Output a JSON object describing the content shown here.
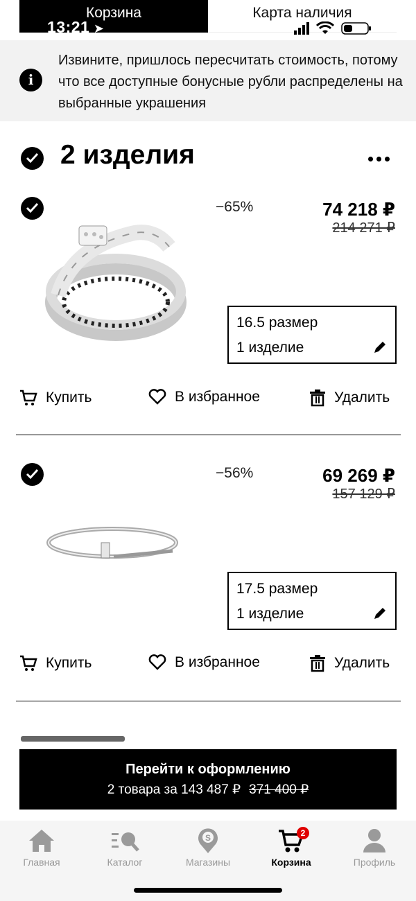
{
  "top_tabs": {
    "active": "Корзина",
    "inactive": "Карта наличия"
  },
  "status_bar": {
    "time": "13:21"
  },
  "notice": {
    "icon": "info-icon",
    "text": "Извините, пришлось пересчитать стоимость, потому что все доступные бонусные рубли распределены на выбранные украшения"
  },
  "header": {
    "title": "2 изделия",
    "more_icon": "more-dots-icon"
  },
  "products": [
    {
      "image": "serpent-ring-image",
      "discount": "−65%",
      "price": "74 218 ₽",
      "old_price": "214 271 ₽",
      "size": "16.5 размер",
      "quantity": "1 изделие"
    },
    {
      "image": "nail-bracelet-image",
      "discount": "−56%",
      "price": "69 269 ₽",
      "old_price": "157 129 ₽",
      "size": "17.5 размер",
      "quantity": "1 изделие"
    }
  ],
  "actions": {
    "buy": "Купить",
    "favorite": "В избранное",
    "delete": "Удалить"
  },
  "checkout": {
    "label": "Перейти к оформлению",
    "summary": "2 товара за 143 487 ₽",
    "old_total": "371 400 ₽"
  },
  "tabbar": {
    "items": [
      {
        "label": "Главная",
        "icon": "home-icon"
      },
      {
        "label": "Каталог",
        "icon": "catalog-icon"
      },
      {
        "label": "Магазины",
        "icon": "stores-icon"
      },
      {
        "label": "Корзина",
        "icon": "cart-icon"
      },
      {
        "label": "Профиль",
        "icon": "profile-icon"
      }
    ],
    "cart_badge": "2",
    "active": "Корзина"
  },
  "colors": {
    "accent": "#000000",
    "badge": "#e00000",
    "notice_bg": "#f2f2f2"
  }
}
